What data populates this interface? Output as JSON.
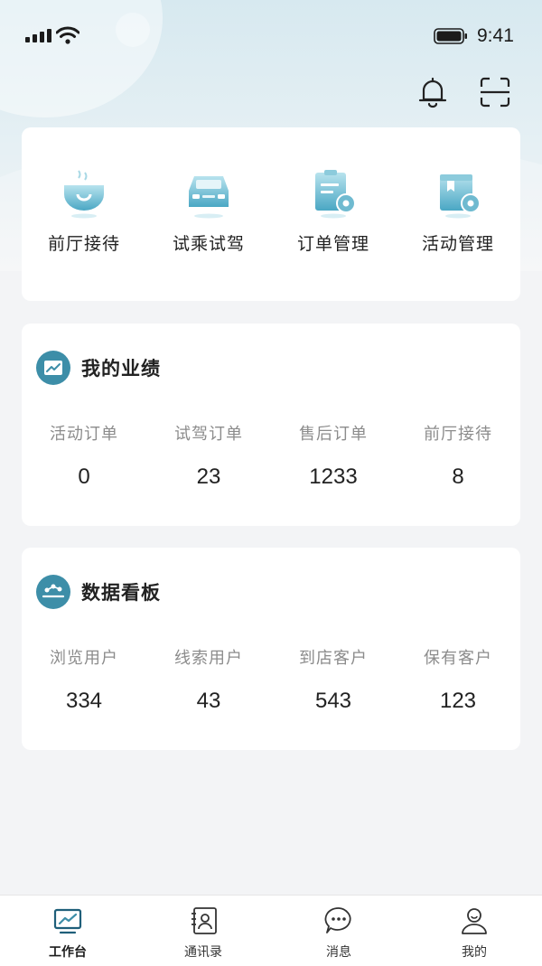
{
  "status_bar": {
    "time": "9:41"
  },
  "quick_actions": [
    {
      "label": "前厅接待",
      "icon": "reception-bowl-icon"
    },
    {
      "label": "试乘试驾",
      "icon": "car-icon"
    },
    {
      "label": "订单管理",
      "icon": "order-settings-icon"
    },
    {
      "label": "活动管理",
      "icon": "activity-settings-icon"
    }
  ],
  "performance": {
    "title": "我的业绩",
    "icon": "trend-chart-icon",
    "stats": [
      {
        "label": "活动订单",
        "value": "0"
      },
      {
        "label": "试驾订单",
        "value": "23"
      },
      {
        "label": "售后订单",
        "value": "1233"
      },
      {
        "label": "前厅接待",
        "value": "8"
      }
    ]
  },
  "dashboard": {
    "title": "数据看板",
    "icon": "data-board-icon",
    "stats": [
      {
        "label": "浏览用户",
        "value": "334"
      },
      {
        "label": "线索用户",
        "value": "43"
      },
      {
        "label": "到店客户",
        "value": "543"
      },
      {
        "label": "保有客户",
        "value": "123"
      }
    ]
  },
  "tabs": [
    {
      "label": "工作台",
      "icon": "workbench-icon",
      "active": true
    },
    {
      "label": "通讯录",
      "icon": "contacts-icon",
      "active": false
    },
    {
      "label": "消息",
      "icon": "message-icon",
      "active": false
    },
    {
      "label": "我的",
      "icon": "profile-icon",
      "active": false
    }
  ],
  "colors": {
    "accent": "#3d8ea8",
    "icon_light": "#9fd3e2",
    "background": "#f3f4f6"
  }
}
